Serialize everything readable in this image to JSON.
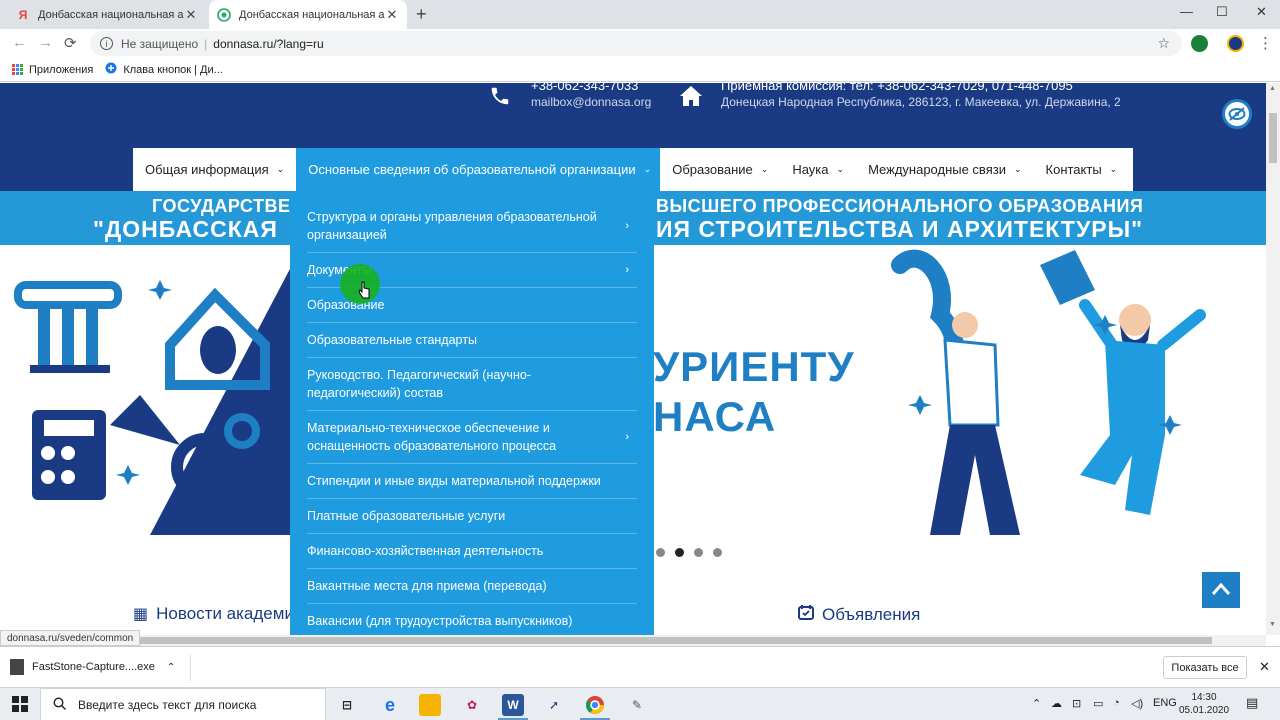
{
  "browser": {
    "tabs": [
      {
        "title": "Донбасская национальная академ",
        "favicon": "yandex-icon",
        "active": false
      },
      {
        "title": "Донбасская национальная академ",
        "favicon": "site-icon",
        "active": true
      }
    ],
    "address": {
      "security": "Не защищено",
      "url": "donnasa.ru/?lang=ru"
    },
    "bookmarks": [
      {
        "label": "Приложения",
        "icon": "apps-grid-icon"
      },
      {
        "label": "Клава кнопок | Ди...",
        "icon": "site-icon"
      }
    ]
  },
  "site": {
    "header": {
      "phone": "+38-062-343-7033",
      "email": "mailbox@donnasa.org",
      "admission": "Приемная комиссия: тел: +38-062-343-7029, 071-448-7095",
      "address": "Донецкая Народная Республика, 286123, г. Макеевка, ул. Державина, 2"
    },
    "nav": [
      {
        "label": "Общая информация"
      },
      {
        "label": "Основные сведения об образовательной организации"
      },
      {
        "label": "Образование"
      },
      {
        "label": "Наука"
      },
      {
        "label": "Международные связи"
      },
      {
        "label": "Контакты"
      }
    ],
    "banner": {
      "line1_left": "ГОСУДАРСТВЕН",
      "line1_right": "ВЫСШЕГО ПРОФЕССИОНАЛЬНОГО ОБРАЗОВАНИЯ",
      "line2_left": "\"ДОНБАССКАЯ",
      "line2_right": "ИЯ СТРОИТЕЛЬСТВА И АРХИТЕКТУРЫ\""
    },
    "hero": {
      "word1": "УРИЕНТУ",
      "word2": "НАСА"
    },
    "carousel": {
      "count": 4,
      "active": 1
    },
    "dropdown": [
      {
        "label": "Структурa и органы управления образовательной организацией",
        "has_sub": true
      },
      {
        "label": "Документы",
        "has_sub": true
      },
      {
        "label": "Образование",
        "has_sub": false
      },
      {
        "label": "Образовательные стандарты",
        "has_sub": false
      },
      {
        "label": "Руководство. Педагогический (научно-педагогический) состав",
        "has_sub": false
      },
      {
        "label": "Материально-техническое обеспечение и оснащенность образовательного процесса",
        "has_sub": true
      },
      {
        "label": "Стипендии и иные виды материальной поддержки",
        "has_sub": false
      },
      {
        "label": "Платные образовательные услуги",
        "has_sub": false
      },
      {
        "label": "Финансово-хозяйственная деятельность",
        "has_sub": false
      },
      {
        "label": "Вакантные места для приема (перевода)",
        "has_sub": false
      },
      {
        "label": "Вакансии (для трудоустройства выпускников)",
        "has_sub": false
      }
    ],
    "sections": {
      "news": "Новости академи",
      "announcements": "Объявления"
    },
    "status_url": "donnasa.ru/sveden/common"
  },
  "downloads": {
    "file": "FastStone-Capture....exe",
    "show_all": "Показать все"
  },
  "taskbar": {
    "search_placeholder": "Введите здесь текст для поиска",
    "lang": "ENG",
    "time": "14:30",
    "date": "05.01.2020"
  },
  "colors": {
    "header_bg": "#1a3b84",
    "menu_bg": "#1f9ce0",
    "banner_bg": "#2599d8",
    "accent": "#1f7fc4"
  }
}
